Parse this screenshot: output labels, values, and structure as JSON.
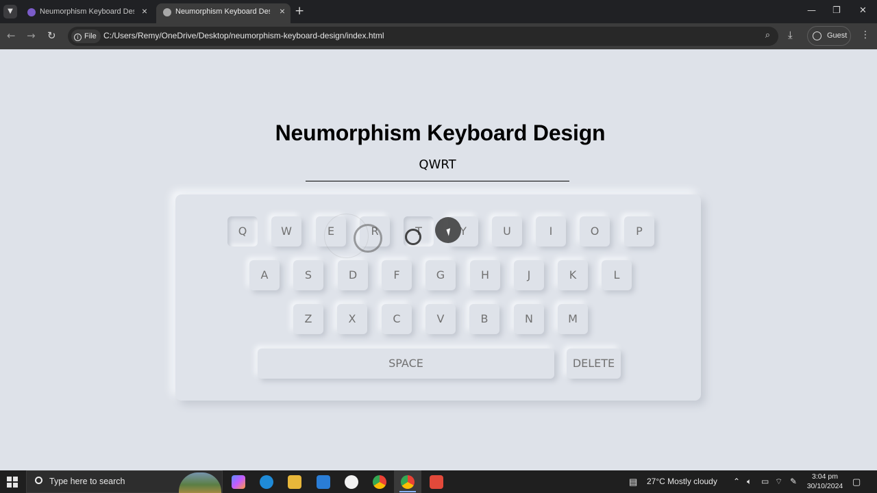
{
  "browser": {
    "tabs": [
      {
        "title": "Neumorphism Keyboard Design",
        "active": false
      },
      {
        "title": "Neumorphism Keyboard Design",
        "active": true
      }
    ],
    "address": {
      "scheme_chip": "File",
      "url": "C:/Users/Remy/OneDrive/Desktop/neumorphism-keyboard-design/index.html"
    },
    "profile": "Guest"
  },
  "page": {
    "heading": "Neumorphism Keyboard Design",
    "typed_text": "QWRT",
    "keyboard": {
      "row1": [
        "Q",
        "W",
        "E",
        "R",
        "T",
        "Y",
        "U",
        "I",
        "O",
        "P"
      ],
      "row2": [
        "A",
        "S",
        "D",
        "F",
        "G",
        "H",
        "J",
        "K",
        "L"
      ],
      "row3": [
        "Z",
        "X",
        "C",
        "V",
        "B",
        "N",
        "M"
      ],
      "space_label": "SPACE",
      "delete_label": "DELETE",
      "pressed_keys": [
        "Q",
        "T"
      ]
    }
  },
  "taskbar": {
    "search_placeholder": "Type here to search",
    "weather": "27°C  Mostly cloudy",
    "time": "3:04 pm",
    "date": "30/10/2024"
  },
  "colors": {
    "page_bg": "#dee2e9",
    "key_text": "#717171",
    "chrome_dark": "#202124",
    "toolbar": "#3c3c3c"
  }
}
